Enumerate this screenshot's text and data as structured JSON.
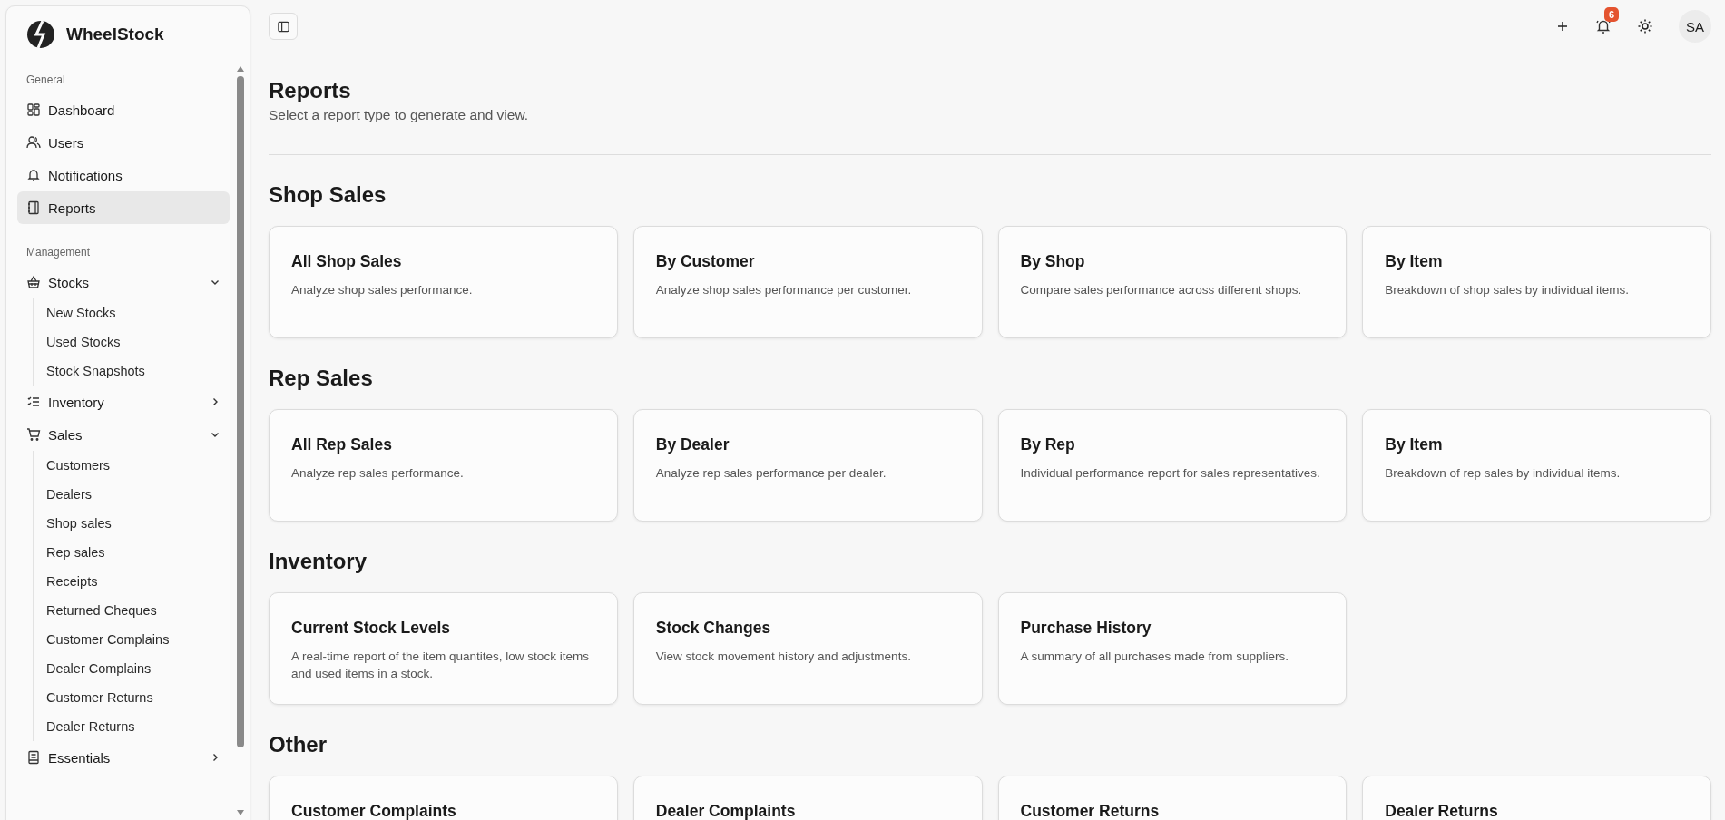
{
  "sidebar": {
    "brand": "WheelStock",
    "groups": [
      {
        "label": "General",
        "items": [
          {
            "label": "Dashboard",
            "selected": false
          },
          {
            "label": "Users",
            "selected": false
          },
          {
            "label": "Notifications",
            "selected": false
          },
          {
            "label": "Reports",
            "selected": true
          }
        ]
      },
      {
        "label": "Management",
        "items": [
          {
            "label": "Stocks",
            "selected": false,
            "expanded": true,
            "children": [
              {
                "label": "New Stocks",
                "selected": false
              },
              {
                "label": "Used Stocks",
                "selected": false
              },
              {
                "label": "Stock Snapshots",
                "selected": false
              }
            ]
          },
          {
            "label": "Inventory",
            "selected": false,
            "expanded": false
          },
          {
            "label": "Sales",
            "selected": false,
            "expanded": true,
            "children": [
              {
                "label": "Customers",
                "selected": false
              },
              {
                "label": "Dealers",
                "selected": false
              },
              {
                "label": "Shop sales",
                "selected": false
              },
              {
                "label": "Rep sales",
                "selected": false
              },
              {
                "label": "Receipts",
                "selected": false
              },
              {
                "label": "Returned Cheques",
                "selected": false
              },
              {
                "label": "Customer Complains",
                "selected": false
              },
              {
                "label": "Dealer Complains",
                "selected": false
              },
              {
                "label": "Customer Returns",
                "selected": false
              },
              {
                "label": "Dealer Returns",
                "selected": false
              }
            ]
          },
          {
            "label": "Essentials",
            "selected": false,
            "expanded": false
          }
        ]
      }
    ]
  },
  "topbar": {
    "notification_count": "6",
    "avatar": "SA"
  },
  "page": {
    "title": "Reports",
    "subtitle": "Select a report type to generate and view."
  },
  "sections": [
    {
      "title": "Shop Sales",
      "cards": [
        {
          "title": "All Shop Sales",
          "description": "Analyze shop sales performance."
        },
        {
          "title": "By Customer",
          "description": "Analyze shop sales performance per customer."
        },
        {
          "title": "By Shop",
          "description": "Compare sales performance across different shops."
        },
        {
          "title": "By Item",
          "description": "Breakdown of shop sales by individual items."
        }
      ]
    },
    {
      "title": "Rep Sales",
      "cards": [
        {
          "title": "All Rep Sales",
          "description": "Analyze rep sales performance."
        },
        {
          "title": "By Dealer",
          "description": "Analyze rep sales performance per dealer."
        },
        {
          "title": "By Rep",
          "description": "Individual performance report for sales representatives."
        },
        {
          "title": "By Item",
          "description": "Breakdown of rep sales by individual items."
        }
      ]
    },
    {
      "title": "Inventory",
      "cards": [
        {
          "title": "Current Stock Levels",
          "description": "A real-time report of the item quantites, low stock items and used items in a stock."
        },
        {
          "title": "Stock Changes",
          "description": "View stock movement history and adjustments."
        },
        {
          "title": "Purchase History",
          "description": "A summary of all purchases made from suppliers."
        }
      ]
    },
    {
      "title": "Other",
      "cards": [
        {
          "title": "Customer Complaints"
        },
        {
          "title": "Dealer Complaints"
        },
        {
          "title": "Customer Returns"
        },
        {
          "title": "Dealer Returns"
        }
      ]
    }
  ]
}
